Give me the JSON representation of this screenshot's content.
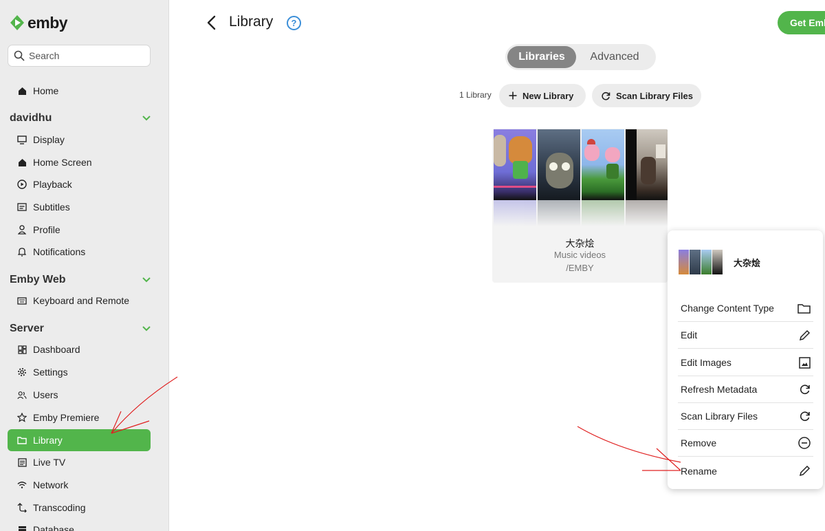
{
  "sidebar": {
    "logo": "emby",
    "search_placeholder": "Search",
    "home": "Home",
    "user_section": "davidhu",
    "user_items": [
      "Display",
      "Home Screen",
      "Playback",
      "Subtitles",
      "Profile",
      "Notifications"
    ],
    "web_section": "Emby Web",
    "web_items": [
      "Keyboard and Remote"
    ],
    "server_section": "Server",
    "server_items": [
      "Dashboard",
      "Settings",
      "Users",
      "Emby Premiere",
      "Library",
      "Live TV",
      "Network",
      "Transcoding",
      "Database"
    ],
    "active_item": "Library"
  },
  "header": {
    "title": "Library",
    "help": "?",
    "get_button": "Get Emby"
  },
  "tabs": [
    "Libraries",
    "Advanced"
  ],
  "toolbar": {
    "count": "1 Library",
    "new_library": "New Library",
    "scan_files": "Scan Library Files"
  },
  "library_card": {
    "name": "大杂烩",
    "type": "Music videos",
    "path": "/EMBY"
  },
  "context_menu": {
    "title": "大杂烩",
    "items": [
      {
        "label": "Change Content Type",
        "icon": "folder-icon"
      },
      {
        "label": "Edit",
        "icon": "pencil-icon"
      },
      {
        "label": "Edit Images",
        "icon": "image-icon"
      },
      {
        "label": "Refresh Metadata",
        "icon": "refresh-icon"
      },
      {
        "label": "Scan Library Files",
        "icon": "refresh-icon"
      },
      {
        "label": "Remove",
        "icon": "minus-circle-icon"
      },
      {
        "label": "Rename",
        "icon": "pencil-icon"
      }
    ]
  },
  "colors": {
    "accent": "#52b54b",
    "help_blue": "#3a8ed8",
    "annotation_red": "#e02020"
  }
}
